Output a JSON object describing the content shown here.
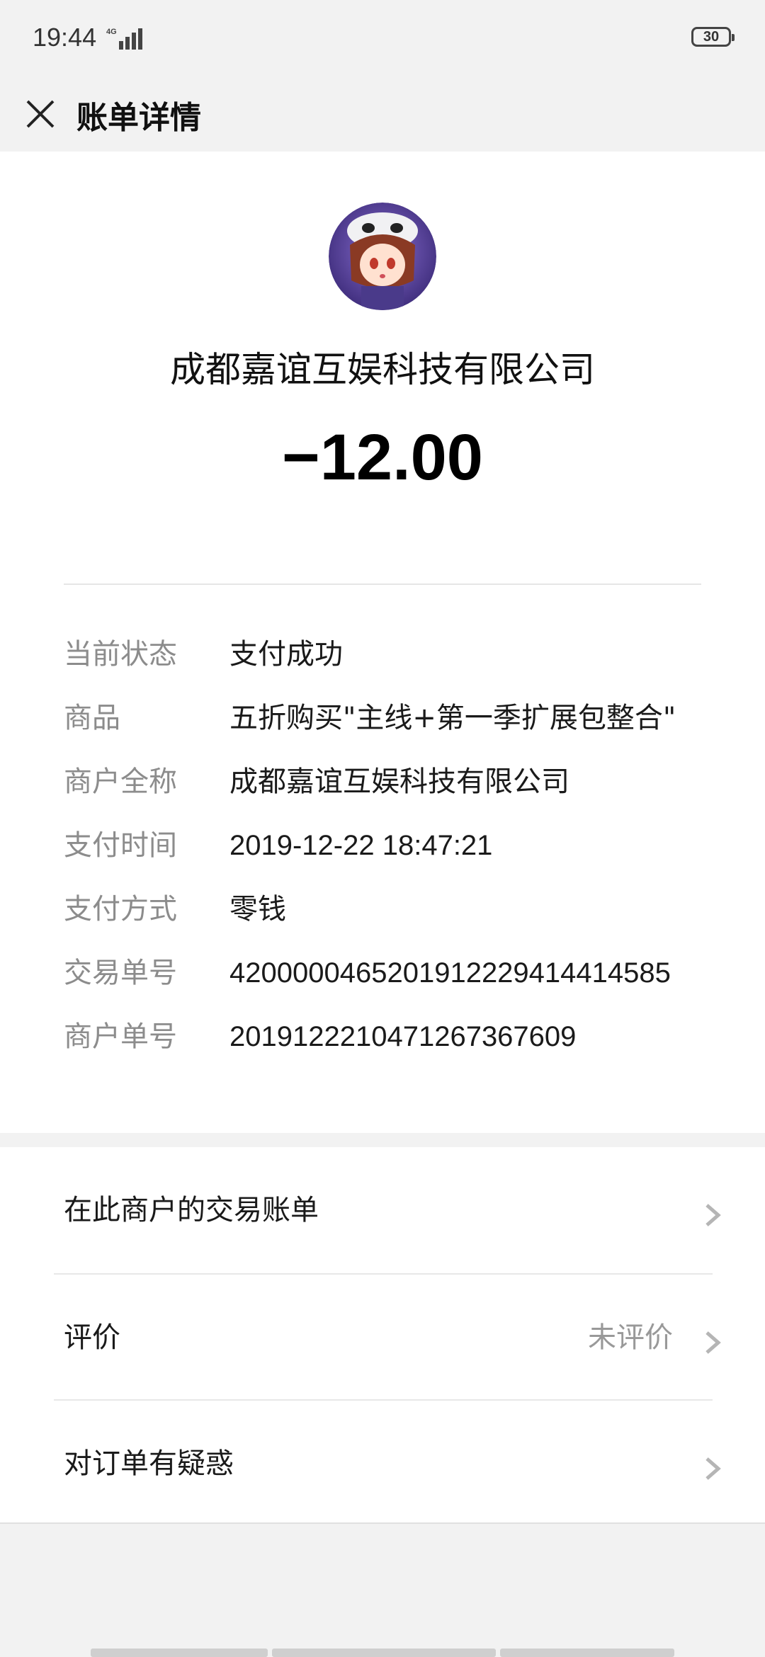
{
  "status_bar": {
    "time": "19:44",
    "network": "4G",
    "battery": "30"
  },
  "nav": {
    "title": "账单详情",
    "close_icon": "close-icon"
  },
  "bill": {
    "merchant_name": "成都嘉谊互娱科技有限公司",
    "amount": "−12.00",
    "details": [
      {
        "label": "当前状态",
        "value": "支付成功"
      },
      {
        "label": "商品",
        "value": "五折购买\"主线+第一季扩展包整合\""
      },
      {
        "label": "商户全称",
        "value": "成都嘉谊互娱科技有限公司"
      },
      {
        "label": "支付时间",
        "value": "2019-12-22 18:47:21"
      },
      {
        "label": "支付方式",
        "value": "零钱"
      },
      {
        "label": "交易单号",
        "value": "4200000465201912229414414585"
      },
      {
        "label": "商户单号",
        "value": "2019122210471267367609"
      }
    ]
  },
  "menu": [
    {
      "label": "在此商户的交易账单",
      "extra": ""
    },
    {
      "label": "评价",
      "extra": "未评价"
    },
    {
      "label": "对订单有疑惑",
      "extra": ""
    }
  ],
  "icons": {
    "chevron": "chevron-right-icon",
    "avatar": "merchant-avatar"
  },
  "colors": {
    "background": "#f2f2f2",
    "card": "#ffffff",
    "label_gray": "#8c8c8c",
    "text": "#1a1a1a"
  }
}
